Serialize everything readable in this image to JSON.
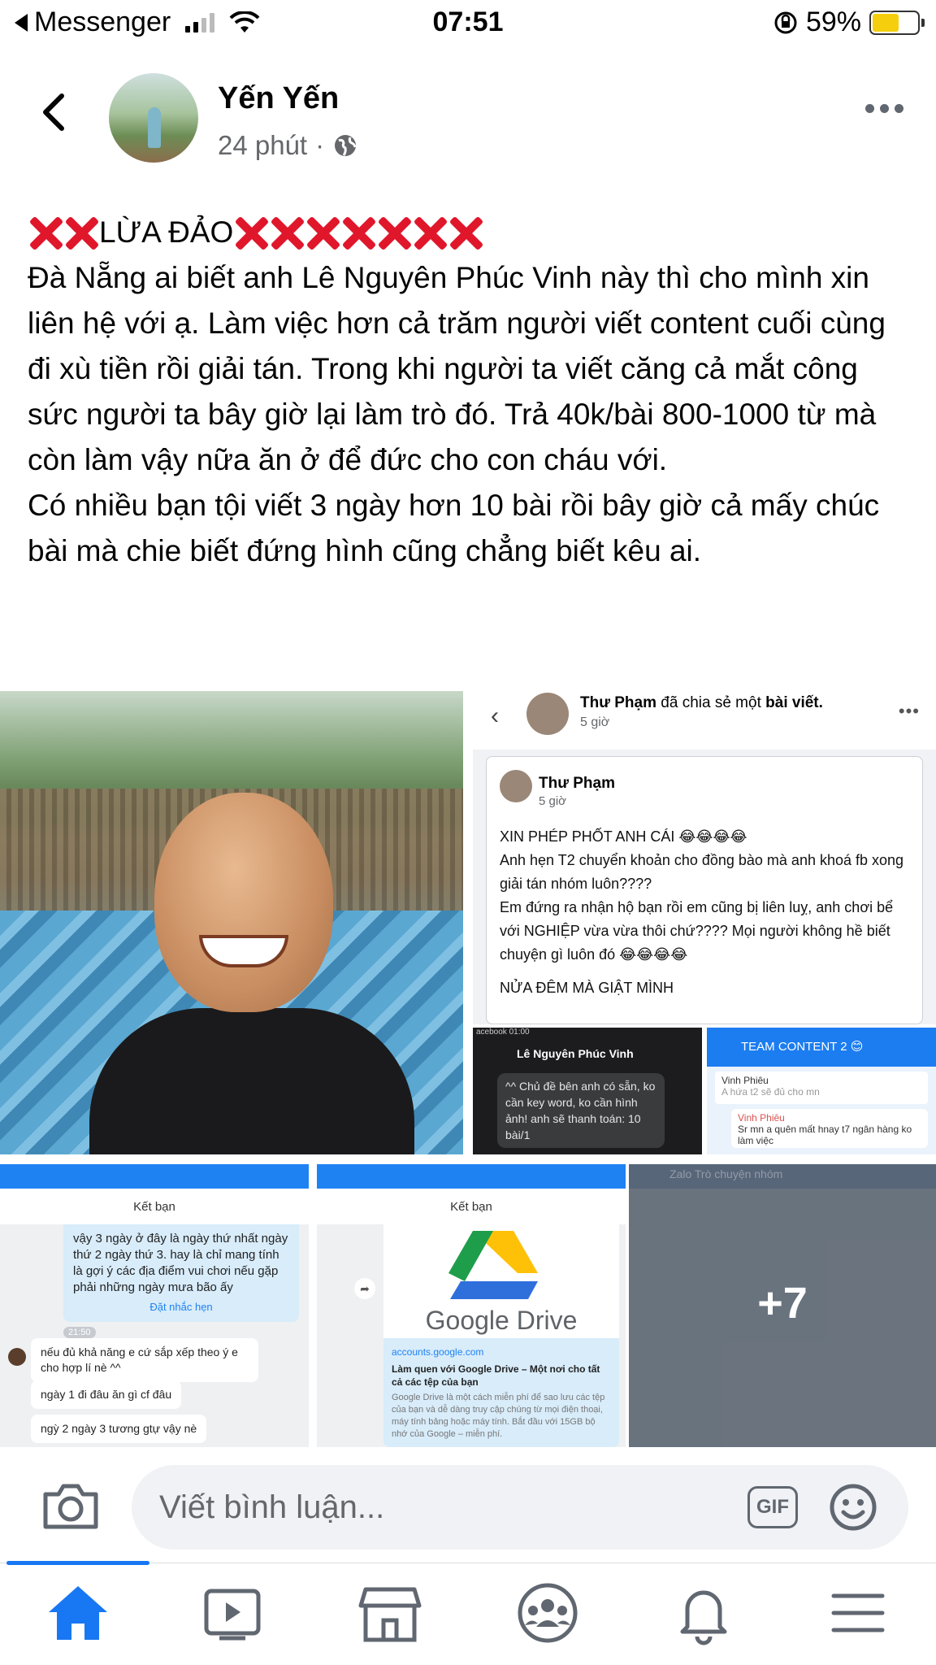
{
  "status_bar": {
    "back_app": "Messenger",
    "time": "07:51",
    "battery": "59%",
    "battery_level": 0.59
  },
  "post": {
    "author": "Yến Yến",
    "time": "24 phút",
    "headline": "LỪA ĐẢO",
    "paragraphs": [
      "Đà Nẵng ai biết anh Lê Nguyên Phúc Vinh này thì cho mình xin liên hệ với ạ. Làm việc hơn cả trăm người viết content cuối cùng đi xù tiền rồi giải tán. Trong khi người ta viết căng cả mắt công sức người ta bây giờ lại làm trò đó. Trả 40k/bài 800-1000 từ mà còn làm vậy nữa ăn ở để đức cho con cháu với.",
      "Có nhiều bạn tội viết 3 ngày hơn 10 bài rồi bây giờ cả mấy chúc bài mà chie biết đứng hình cũng chẳng biết kêu ai."
    ]
  },
  "shared_post": {
    "sharer": "Thư Phạm",
    "share_action": "đã chia sẻ một",
    "share_object": "bài viết.",
    "share_time": "5 giờ",
    "card_author": "Thư Phạm",
    "card_time": "5 giờ",
    "card_lines": [
      "XIN PHÉP PHỐT ANH CÁI 😂😂😂😂",
      "Anh hẹn T2 chuyển khoản cho đồng bào mà anh khoá fb xong giải tán nhóm luôn????",
      "Em đứng ra nhận hộ bạn rồi em cũng bị liên luỵ, anh chơi bể với NGHIỆP vừa vừa thôi chứ???? Mọi người không hề biết chuyện gì luôn đó 😂😂😂😂",
      "",
      "NỬA ĐÊM MÀ GIẬT MÌNH"
    ]
  },
  "chat_dark": {
    "status": "acebook  01:00",
    "name": "Lê Nguyên Phúc Vinh",
    "bubble": "^^ Chủ đề bên anh có sẵn, ko cần key word, ko cần hình ảnh! anh sẽ thanh toán: 10 bài/1"
  },
  "chat_team": {
    "title": "TEAM CONTENT 2 😊",
    "msg1_name": "Vinh Phiêu",
    "msg1_text": "A hứa t2 sẽ đủ cho mn",
    "msg2_name": "Vinh Phiêu",
    "msg2_text": "Sr mn a quên mất hnay t7 ngân hàng ko làm việc"
  },
  "zalo_chat_1": {
    "add_friend": "Kết bạn",
    "tip": "vậy 3 ngày ở đây là ngày thứ nhất ngày thứ 2 ngày thứ 3. hay là chỉ mang tính là gợi ý các địa điểm vui chơi nếu gặp phải những ngày mưa bão ấy",
    "tip_link": "Đặt nhắc hẹn",
    "stamp": "21:50",
    "messages": [
      "nếu đủ khả năng e cứ sắp xếp theo ý e cho hợp lí nè ^^",
      "ngày 1 đi đâu ăn gì cf đâu",
      "ngỳ 2 ngày 3 tương gtự vậy nè"
    ]
  },
  "zalo_chat_2": {
    "add_friend": "Kết bạn",
    "drive_logo_text": "Google Drive",
    "url": "accounts.google.com",
    "title": "Làm quen với Google Drive – Một nơi cho tất cả các tệp của bạn",
    "desc": "Google Drive là một cách miễn phí để sao lưu các tệp của bạn và dễ dàng truy cập chúng từ mọi điện thoại, máy tính bảng hoặc máy tính. Bắt đầu với 15GB bộ nhớ của Google – miễn phí."
  },
  "zalo_group": {
    "title": "Zalo Trò chuyện nhóm",
    "more_count": "+7"
  },
  "comment": {
    "placeholder": "Viết bình luận...",
    "gif_label": "GIF"
  },
  "tabs": [
    "home-icon",
    "video-icon",
    "marketplace-icon",
    "groups-icon",
    "notifications-icon",
    "menu-icon"
  ],
  "colors": {
    "accent": "#1877f2",
    "cross_red": "#e0162b",
    "secondary_text": "#65676b"
  }
}
